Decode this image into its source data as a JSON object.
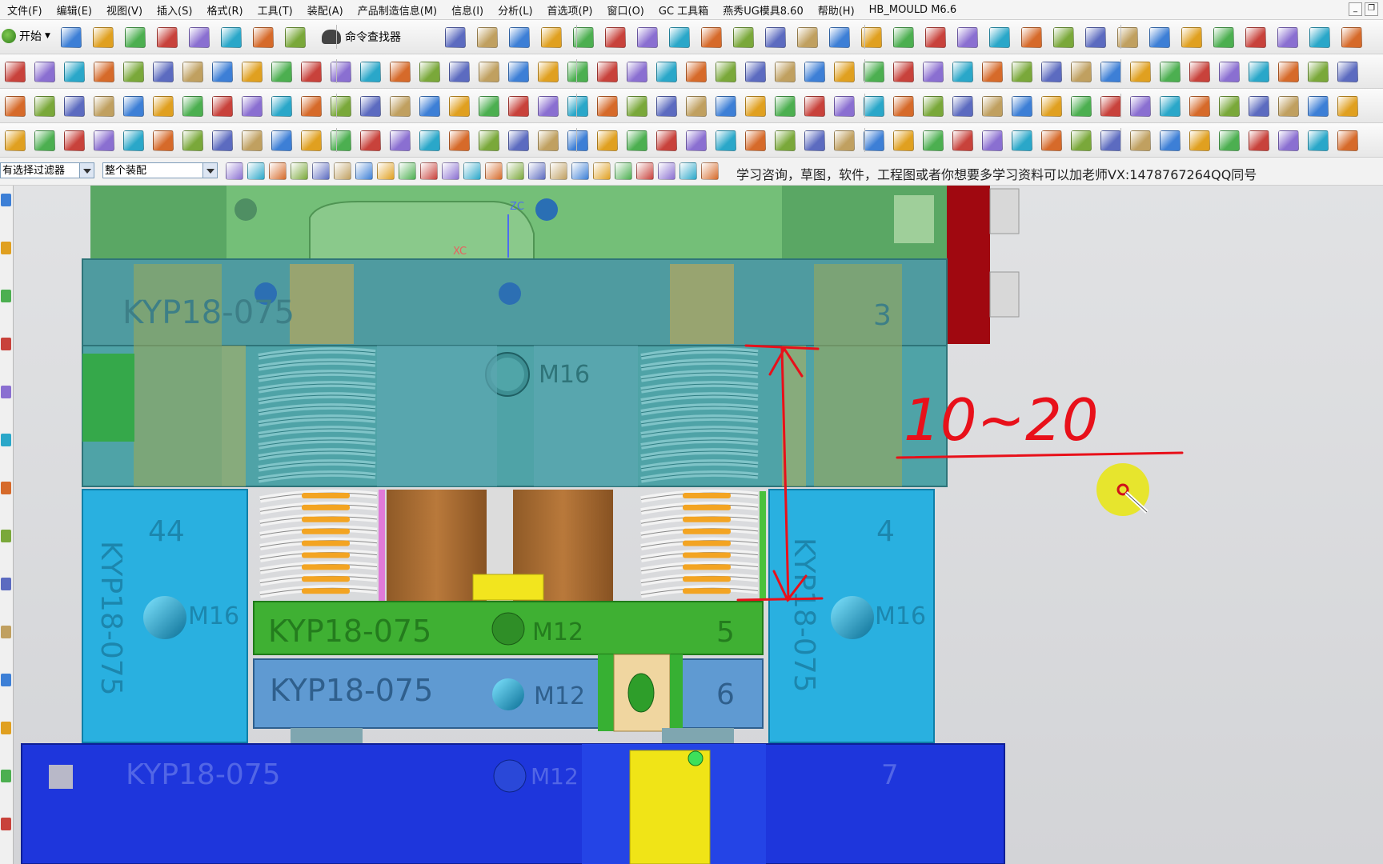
{
  "menu": [
    "文件(F)",
    "编辑(E)",
    "视图(V)",
    "插入(S)",
    "格式(R)",
    "工具(T)",
    "装配(A)",
    "产品制造信息(M)",
    "信息(I)",
    "分析(L)",
    "首选项(P)",
    "窗口(O)",
    "GC 工具箱",
    "燕秀UG模具8.60",
    "帮助(H)",
    "HB_MOULD M6.6"
  ],
  "toolbar": {
    "start_label": "开始",
    "command_finder_label": "命令查找器",
    "filter_select": "有选择过滤器",
    "scope_select": "整个装配",
    "cue_text": "学习咨询，草图，软件，工程图或者你想要多学习资料可以加老师VX:1478767264QQ同号"
  },
  "viewport": {
    "axis_labels": {
      "zc": "ZC",
      "xc": "XC"
    },
    "plate_labels": {
      "top_plate_code": "KYP18-075",
      "top_plate_number": "3",
      "top_bolt": "M16",
      "left_block_number": "44",
      "left_block_code": "KYP18-075",
      "left_block_bolt": "M16",
      "right_block_number": "4",
      "right_block_code": "KYP18-075",
      "right_block_bolt": "M16",
      "green_plate_code": "KYP18-075",
      "green_plate_bolt": "M12",
      "green_plate_number": "5",
      "blue_plate_code": "KYP18-075",
      "blue_plate_bolt": "M12",
      "blue_plate_number": "6",
      "bottom_plate_code": "KYP18-075",
      "bottom_plate_bolt": "M12",
      "bottom_plate_number": "7"
    },
    "annotation": "10~20",
    "colors": {
      "annotation": "#e8101a",
      "green_plate": "#3fb033",
      "blue_block": "#29b0e0",
      "bottom_plate": "#1e36dc"
    }
  }
}
